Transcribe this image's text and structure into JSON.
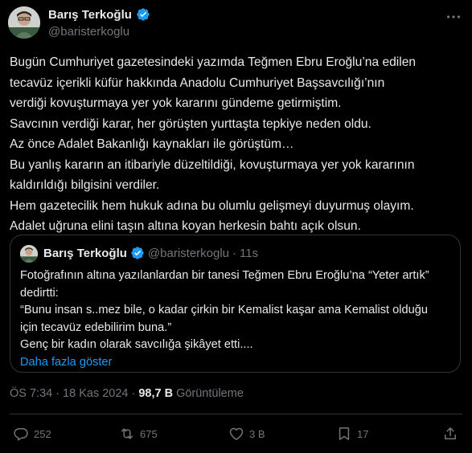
{
  "author": {
    "name": "Barış Terkoğlu",
    "handle": "@baristerkoglu"
  },
  "tweet": {
    "lines": [
      "Bugün Cumhuriyet gazetesindeki yazımda Teğmen Ebru Eroğlu’na edilen",
      "tecavüz içerikli küfür hakkında Anadolu Cumhuriyet Başsavcılığı’nın",
      "verdiği kovuşturmaya yer yok kararını gündeme getirmiştim.",
      "Savcının verdiği karar, her görüşten yurttaşta tepkiye neden oldu.",
      "Az önce Adalet Bakanlığı kaynakları ile görüştüm…",
      "Bu yanlış kararın an itibariyle düzeltildiği, kovuşturmaya yer yok kararının",
      "kaldırıldığı bilgisini verdiler.",
      "Hem gazetecilik hem hukuk adına bu olumlu gelişmeyi duyurmuş olayım.",
      "Adalet uğruna elini taşın altına koyan herkesin bahtı açık olsun."
    ]
  },
  "quote": {
    "name": "Barış Terkoğlu",
    "handle": "@baristerkoglu",
    "dot": "·",
    "time": "11s",
    "lines": [
      "Fotoğrafının altına yazılanlardan bir tanesi Teğmen Ebru Eroğlu’na “Yeter artık”",
      "dedirtti:",
      "“Bunu insan s..mez bile, o kadar çirkin bir Kemalist kaşar ama Kemalist olduğu",
      "için tecavüz edebilirim buna.”",
      "Genç bir kadın olarak savcılığa şikâyet etti...."
    ],
    "show_more": "Daha fazla göster"
  },
  "meta": {
    "time": "ÖS 7:34",
    "separator": "·",
    "date": "18 Kas 2024",
    "views_count": "98,7 B",
    "views_label": "Görüntüleme"
  },
  "actions": {
    "replies": "252",
    "reposts": "675",
    "likes": "3 B",
    "bookmarks": "17"
  },
  "colors": {
    "background": "#000000",
    "text": "#e7e9ea",
    "secondary": "#71767b",
    "accent": "#1d9bf0",
    "border": "#2f3336"
  }
}
